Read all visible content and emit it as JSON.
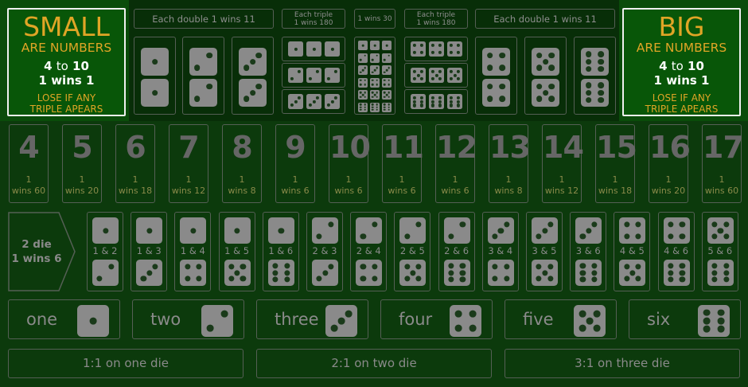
{
  "small": {
    "title": "SMALL",
    "subtitle": "ARE NUMBERS",
    "range_from": "4",
    "range_to_word": "to",
    "range_to": "10",
    "payout": "1 wins 1",
    "note_line1": "LOSE IF ANY",
    "note_line2": "TRIPLE APEARS"
  },
  "big": {
    "title": "BIG",
    "subtitle": "ARE NUMBERS",
    "range_from": "4",
    "range_to_word": "to",
    "range_to": "10",
    "payout": "1 wins 1",
    "note_line1": "LOSE IF ANY",
    "note_line2": "TRIPLE APEARS"
  },
  "doubles": {
    "label_left": "Each double 1 wins 11",
    "label_right": "Each double 1 wins 11"
  },
  "triples": {
    "left_line1": "Each triple",
    "left_line2": "1 wins 180",
    "any_label": "1 wins 30",
    "right_line1": "Each triple",
    "right_line2": "1 wins 180"
  },
  "totals": [
    {
      "value": "4",
      "odds_a": "1",
      "odds_b": "wins 60"
    },
    {
      "value": "5",
      "odds_a": "1",
      "odds_b": "wins 20"
    },
    {
      "value": "6",
      "odds_a": "1",
      "odds_b": "wins 18"
    },
    {
      "value": "7",
      "odds_a": "1",
      "odds_b": "wins 12"
    },
    {
      "value": "8",
      "odds_a": "1",
      "odds_b": "wins 8"
    },
    {
      "value": "9",
      "odds_a": "1",
      "odds_b": "wins 6"
    },
    {
      "value": "10",
      "odds_a": "1",
      "odds_b": "wins 6"
    },
    {
      "value": "11",
      "odds_a": "1",
      "odds_b": "wins 6"
    },
    {
      "value": "12",
      "odds_a": "1",
      "odds_b": "wins 6"
    },
    {
      "value": "13",
      "odds_a": "1",
      "odds_b": "wins 8"
    },
    {
      "value": "14",
      "odds_a": "1",
      "odds_b": "wins 12"
    },
    {
      "value": "15",
      "odds_a": "1",
      "odds_b": "wins 18"
    },
    {
      "value": "16",
      "odds_a": "1",
      "odds_b": "wins 20"
    },
    {
      "value": "17",
      "odds_a": "1",
      "odds_b": "wins 60"
    }
  ],
  "two_die": {
    "line1": "2 die",
    "line2": "1 wins 6"
  },
  "pairs": [
    {
      "label": "1 & 2",
      "a": 1,
      "b": 2
    },
    {
      "label": "1 & 3",
      "a": 1,
      "b": 3
    },
    {
      "label": "1 & 4",
      "a": 1,
      "b": 4
    },
    {
      "label": "1 & 5",
      "a": 1,
      "b": 5
    },
    {
      "label": "1 & 6",
      "a": 1,
      "b": 6
    },
    {
      "label": "2 & 3",
      "a": 2,
      "b": 3
    },
    {
      "label": "2 & 4",
      "a": 2,
      "b": 4
    },
    {
      "label": "2 & 5",
      "a": 2,
      "b": 5
    },
    {
      "label": "2 & 6",
      "a": 2,
      "b": 6
    },
    {
      "label": "3 & 4",
      "a": 3,
      "b": 4
    },
    {
      "label": "3 & 5",
      "a": 3,
      "b": 5
    },
    {
      "label": "3 & 6",
      "a": 3,
      "b": 6
    },
    {
      "label": "4 & 5",
      "a": 4,
      "b": 5
    },
    {
      "label": "4 & 6",
      "a": 4,
      "b": 6
    },
    {
      "label": "5 & 6",
      "a": 5,
      "b": 6
    }
  ],
  "singles": [
    {
      "word": "one",
      "face": 1
    },
    {
      "word": "two",
      "face": 2
    },
    {
      "word": "three",
      "face": 3
    },
    {
      "word": "four",
      "face": 4
    },
    {
      "word": "five",
      "face": 5
    },
    {
      "word": "six",
      "face": 6
    }
  ],
  "payouts": [
    "1:1 on one die",
    "2:1 on two die",
    "3:1 on three die"
  ],
  "colors": {
    "felt": "#0c3a0c",
    "side_panel": "#085608",
    "accent": "#e0a526",
    "die": "#8a8a8a"
  }
}
